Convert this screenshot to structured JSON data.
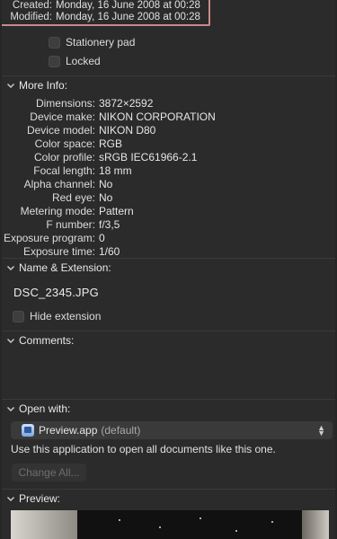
{
  "dates": {
    "created_label": "Created:",
    "created_value": "Monday, 16 June 2008 at 00:28",
    "modified_label": "Modified:",
    "modified_value": "Monday, 16 June 2008 at 00:28"
  },
  "options": {
    "stationery_pad": "Stationery pad",
    "locked": "Locked"
  },
  "more_info": {
    "title": "More Info:",
    "rows": [
      {
        "key": "Dimensions:",
        "value": "3872×2592"
      },
      {
        "key": "Device make:",
        "value": "NIKON CORPORATION"
      },
      {
        "key": "Device model:",
        "value": "NIKON D80"
      },
      {
        "key": "Color space:",
        "value": "RGB"
      },
      {
        "key": "Color profile:",
        "value": "sRGB IEC61966-2.1"
      },
      {
        "key": "Focal length:",
        "value": "18 mm"
      },
      {
        "key": "Alpha channel:",
        "value": "No"
      },
      {
        "key": "Red eye:",
        "value": "No"
      },
      {
        "key": "Metering mode:",
        "value": "Pattern"
      },
      {
        "key": "F number:",
        "value": "f/3,5"
      },
      {
        "key": "Exposure program:",
        "value": "0"
      },
      {
        "key": "Exposure time:",
        "value": "1/60"
      }
    ]
  },
  "name_extension": {
    "title": "Name & Extension:",
    "filename": "DSC_2345.JPG",
    "hide_extension": "Hide extension"
  },
  "comments": {
    "title": "Comments:"
  },
  "open_with": {
    "title": "Open with:",
    "app": "Preview.app",
    "app_suffix": "(default)",
    "description": "Use this application to open all documents like this one.",
    "change_all": "Change All..."
  },
  "preview": {
    "title": "Preview:"
  },
  "colors": {
    "background": "#2b2b2b",
    "highlight": "#c98a8a",
    "text": "#e6e6e6",
    "disabled": "#6e6e6e"
  }
}
